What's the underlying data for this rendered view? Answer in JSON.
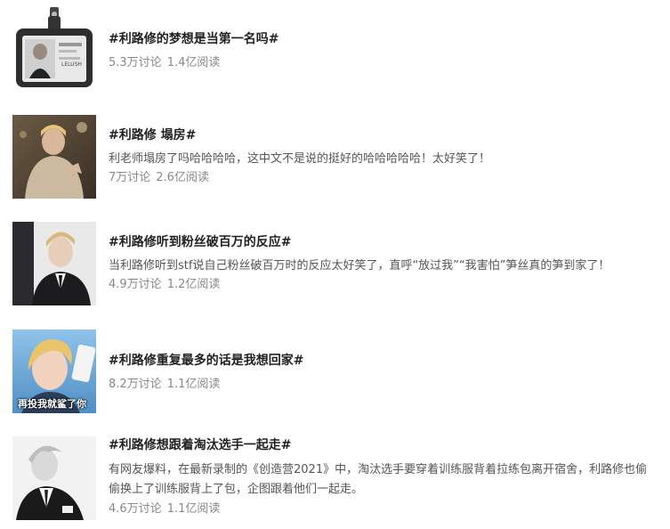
{
  "topics": [
    {
      "title": "#利路修的梦想是当第一名吗#",
      "desc": "",
      "discussions": "5.3万讨论",
      "reads": "1.4亿阅读",
      "image_label": "LELUSH",
      "image_caption": ""
    },
    {
      "title": "#利路修 塌房#",
      "desc": "利老师塌房了吗哈哈哈哈，这中文不是说的挺好的哈哈哈哈哈！太好笑了！",
      "discussions": "7万讨论",
      "reads": "2.6亿阅读",
      "image_label": "",
      "image_caption": ""
    },
    {
      "title": "#利路修听到粉丝破百万的反应#",
      "desc": "当利路修听到stf说自己粉丝破百万时的反应太好笑了，直呼“放过我”“我害怕”笋丝真的笋到家了！",
      "discussions": "4.9万讨论",
      "reads": "1.2亿阅读",
      "image_label": "",
      "image_caption": ""
    },
    {
      "title": "#利路修重复最多的话是我想回家#",
      "desc": "",
      "discussions": "8.2万讨论",
      "reads": "1.1亿阅读",
      "image_label": "",
      "image_caption": "再投我就鲨了你"
    },
    {
      "title": "#利路修想跟着淘汰选手一起走#",
      "desc": "有网友爆料，在最新录制的《创造营2021》中，淘汰选手要穿着训练服背着拉练包离开宿舍，利路修也偷偷换上了训练服背上了包，企图跟着他们一起走。",
      "discussions": "4.6万讨论",
      "reads": "1.1亿阅读",
      "image_label": "",
      "image_caption": ""
    }
  ]
}
